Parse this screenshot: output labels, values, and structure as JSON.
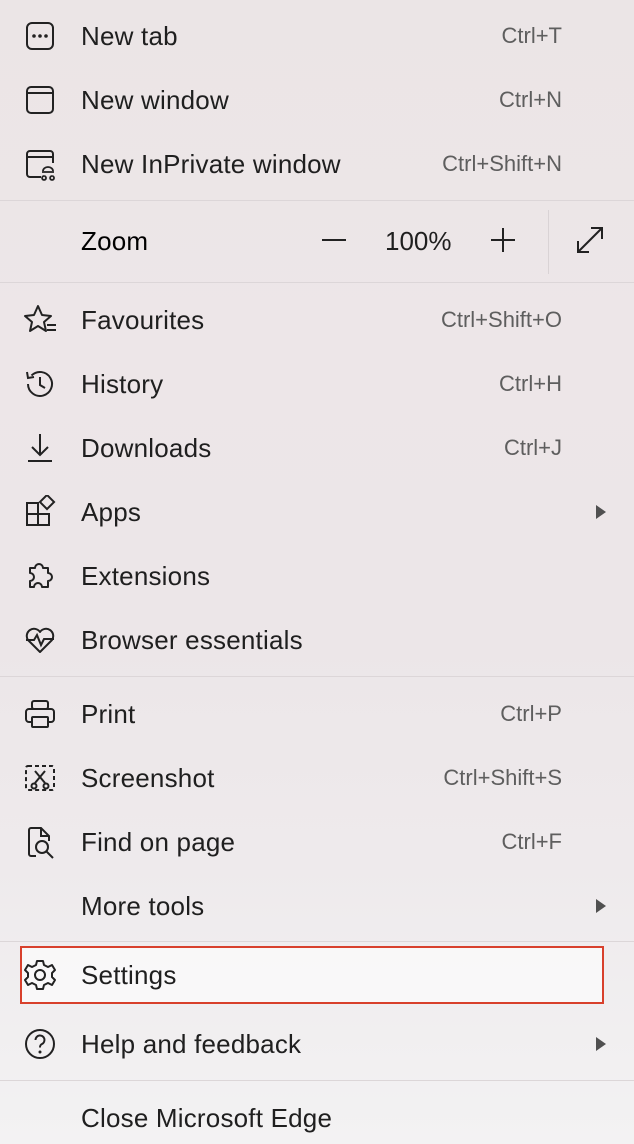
{
  "menu": {
    "new_tab": {
      "label": "New tab",
      "shortcut": "Ctrl+T"
    },
    "new_window": {
      "label": "New window",
      "shortcut": "Ctrl+N"
    },
    "new_inprivate": {
      "label": "New InPrivate window",
      "shortcut": "Ctrl+Shift+N"
    },
    "zoom": {
      "label": "Zoom",
      "value": "100%",
      "minus_icon": "minus-icon",
      "plus_icon": "plus-icon",
      "fullscreen_icon": "fullscreen-icon"
    },
    "favourites": {
      "label": "Favourites",
      "shortcut": "Ctrl+Shift+O"
    },
    "history": {
      "label": "History",
      "shortcut": "Ctrl+H"
    },
    "downloads": {
      "label": "Downloads",
      "shortcut": "Ctrl+J"
    },
    "apps": {
      "label": "Apps"
    },
    "extensions": {
      "label": "Extensions"
    },
    "browser_essentials": {
      "label": "Browser essentials"
    },
    "print": {
      "label": "Print",
      "shortcut": "Ctrl+P"
    },
    "screenshot": {
      "label": "Screenshot",
      "shortcut": "Ctrl+Shift+S"
    },
    "find_on_page": {
      "label": "Find on page",
      "shortcut": "Ctrl+F"
    },
    "more_tools": {
      "label": "More tools"
    },
    "settings": {
      "label": "Settings"
    },
    "help_feedback": {
      "label": "Help and feedback"
    },
    "close_edge": {
      "label": "Close Microsoft Edge"
    }
  },
  "colors": {
    "highlight_border": "#d8402c",
    "text": "#1f1f1f",
    "shortcut_text": "#5e5e5e"
  }
}
